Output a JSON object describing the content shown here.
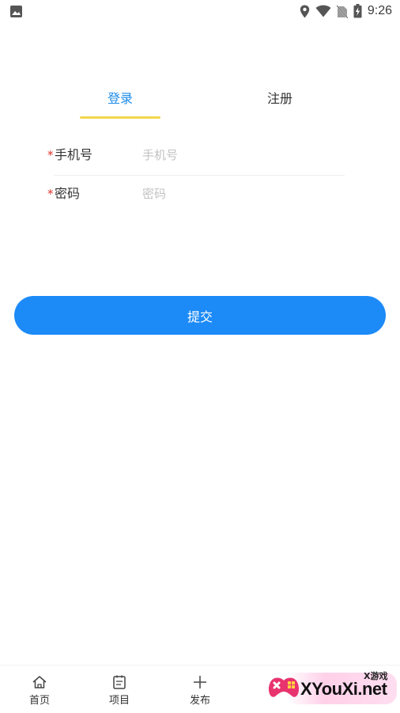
{
  "status_bar": {
    "time": "9:26",
    "icons": [
      "image-icon",
      "location-icon",
      "wifi-icon",
      "no-sim-icon",
      "battery-charging-icon"
    ]
  },
  "tabs": [
    {
      "label": "登录",
      "active": true
    },
    {
      "label": "注册",
      "active": false
    }
  ],
  "form": {
    "phone": {
      "label": "手机号",
      "required_mark": "*",
      "placeholder": "手机号",
      "value": ""
    },
    "password": {
      "label": "密码",
      "required_mark": "*",
      "placeholder": "密码",
      "value": ""
    }
  },
  "submit_label": "提交",
  "bottom_nav": [
    {
      "label": "首页",
      "icon": "home-icon"
    },
    {
      "label": "项目",
      "icon": "document-icon"
    },
    {
      "label": "发布",
      "icon": "plus-icon"
    }
  ],
  "watermark": {
    "cn": "X游戏",
    "en": "XYouXi.net"
  },
  "colors": {
    "accent": "#1e8bea",
    "button": "#1c8af7",
    "underline": "#f2d64e",
    "required": "#e0322a"
  }
}
